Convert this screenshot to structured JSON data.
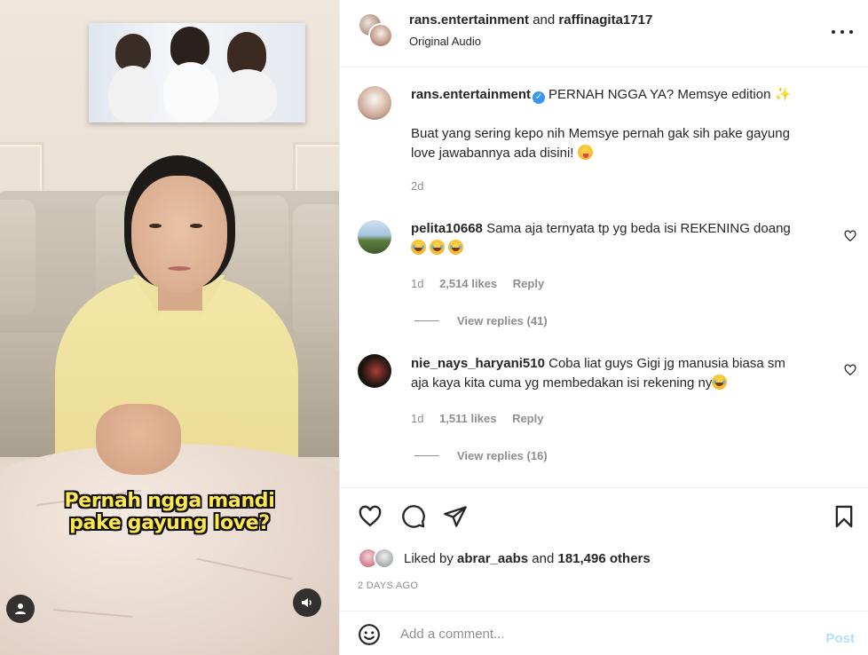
{
  "video": {
    "caption_line1": "Pernah ngga mandi",
    "caption_line2": "pake gayung love?"
  },
  "header": {
    "user1": "rans.entertainment",
    "and": "and",
    "user2": "raffinagita1717",
    "audio": "Original Audio"
  },
  "post_caption": {
    "username": "rans.entertainment",
    "title": "PERNAH NGGA YA? Memsye edition",
    "body_line1": "Buat yang sering kepo nih Memsye pernah gak sih pake gayung",
    "body_line2": "love jawabannya ada disini!",
    "time": "2d"
  },
  "comments": [
    {
      "username": "pelita10668",
      "text": "Sama aja ternyata tp yg beda isi REKENING doang",
      "time": "1d",
      "likes": "2,514 likes",
      "reply": "Reply",
      "view_replies": "View replies (41)"
    },
    {
      "username": "nie_nays_haryani510",
      "text_line1": "Coba liat guys Gigi jg manusia biasa sm",
      "text_line2": "aja kaya kita cuma yg membedakan isi rekening ny",
      "time": "1d",
      "likes": "1,511 likes",
      "reply": "Reply",
      "view_replies": "View replies (16)"
    }
  ],
  "likes": {
    "prefix": "Liked by",
    "user": "abrar_aabs",
    "and": "and",
    "others": "181,496 others"
  },
  "date": "2 DAYS AGO",
  "add_comment": {
    "placeholder": "Add a comment...",
    "post_label": "Post"
  },
  "colors": {
    "text": "#262626",
    "secondary": "#8e8e8e",
    "verified": "#3897f0",
    "post_disabled": "#b2dffc",
    "caption_yellow": "#ffe84c"
  }
}
